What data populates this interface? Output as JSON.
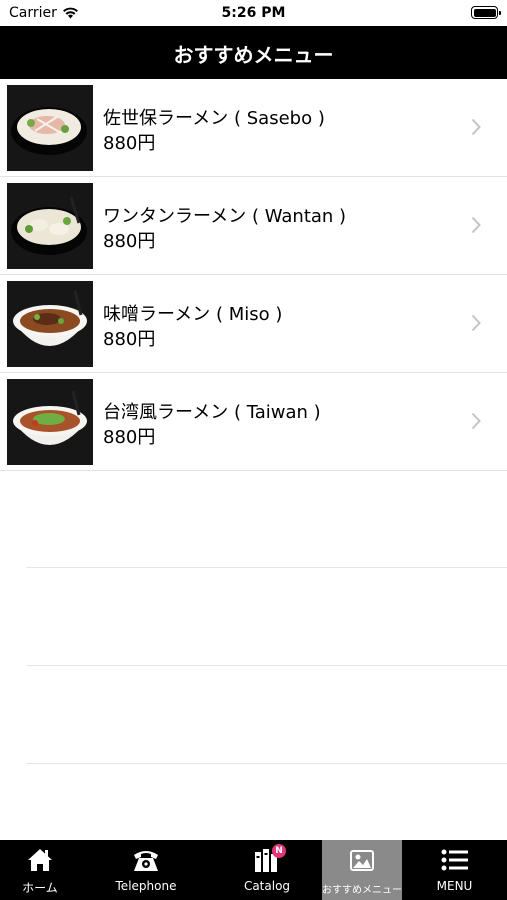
{
  "status": {
    "carrier": "Carrier",
    "time": "5:26 PM"
  },
  "header": {
    "title": "おすすめメニュー"
  },
  "items": [
    {
      "name": "佐世保ラーメン ( Sasebo )",
      "price": "880円"
    },
    {
      "name": "ワンタンラーメン ( Wantan )",
      "price": "880円"
    },
    {
      "name": "味噌ラーメン ( Miso )",
      "price": "880円"
    },
    {
      "name": "台湾風ラーメン ( Taiwan )",
      "price": "880円"
    }
  ],
  "tabs": {
    "home": "ホーム",
    "telephone": "Telephone",
    "catalog": "Catalog",
    "catalog_badge": "N",
    "recommended": "おすすめメニュー",
    "menu": "MENU"
  },
  "colors": {
    "nav": "#000000",
    "tab_active": "#8a8a8a",
    "badge": "#e2367a"
  }
}
